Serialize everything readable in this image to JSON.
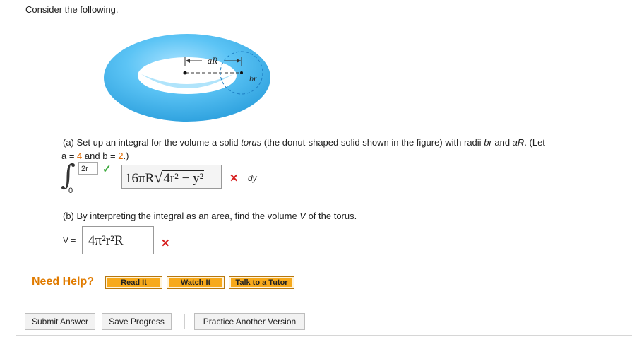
{
  "intro": "Consider the following.",
  "figure": {
    "label_aR": "aR",
    "label_br": "br",
    "colors": {
      "torus": "#3db4ee",
      "torus_light": "#8fd6fb",
      "hole": "#ffffff"
    }
  },
  "part_a": {
    "prefix": "(a) Set up an integral for the volume a solid ",
    "torus_word": "torus",
    "middle": " (the donut-shaped solid shown in the figure) with radii ",
    "br": "br",
    "and": " and ",
    "aR": "aR",
    "suffix": ". (Let",
    "line2_a": "a = ",
    "a_value": "4",
    "line2_and": " and ",
    "line2_b": "b = ",
    "b_value": "2",
    "line2_end": ".)",
    "upper_limit": "2r",
    "lower_limit": "0",
    "integrand_prefix": "16πR",
    "integrand_radicand": "4r² − y²",
    "differential": "dy",
    "upper_status": "correct",
    "integrand_status": "incorrect"
  },
  "part_b": {
    "question_prefix": "(b) By interpreting the integral as an area, find the volume ",
    "var_V": "V",
    "question_suffix": " of the torus.",
    "v_label": "V =",
    "answer": "4π²r²R",
    "status": "incorrect"
  },
  "help": {
    "title": "Need Help?",
    "buttons": [
      "Read It",
      "Watch It",
      "Talk to a Tutor"
    ]
  },
  "actions": {
    "submit": "Submit Answer",
    "save": "Save Progress",
    "practice": "Practice Another Version"
  },
  "colors": {
    "highlight": "#e06a00",
    "correct": "#3aa83a",
    "incorrect": "#d61f1f",
    "help_button": "#f7a91b"
  }
}
